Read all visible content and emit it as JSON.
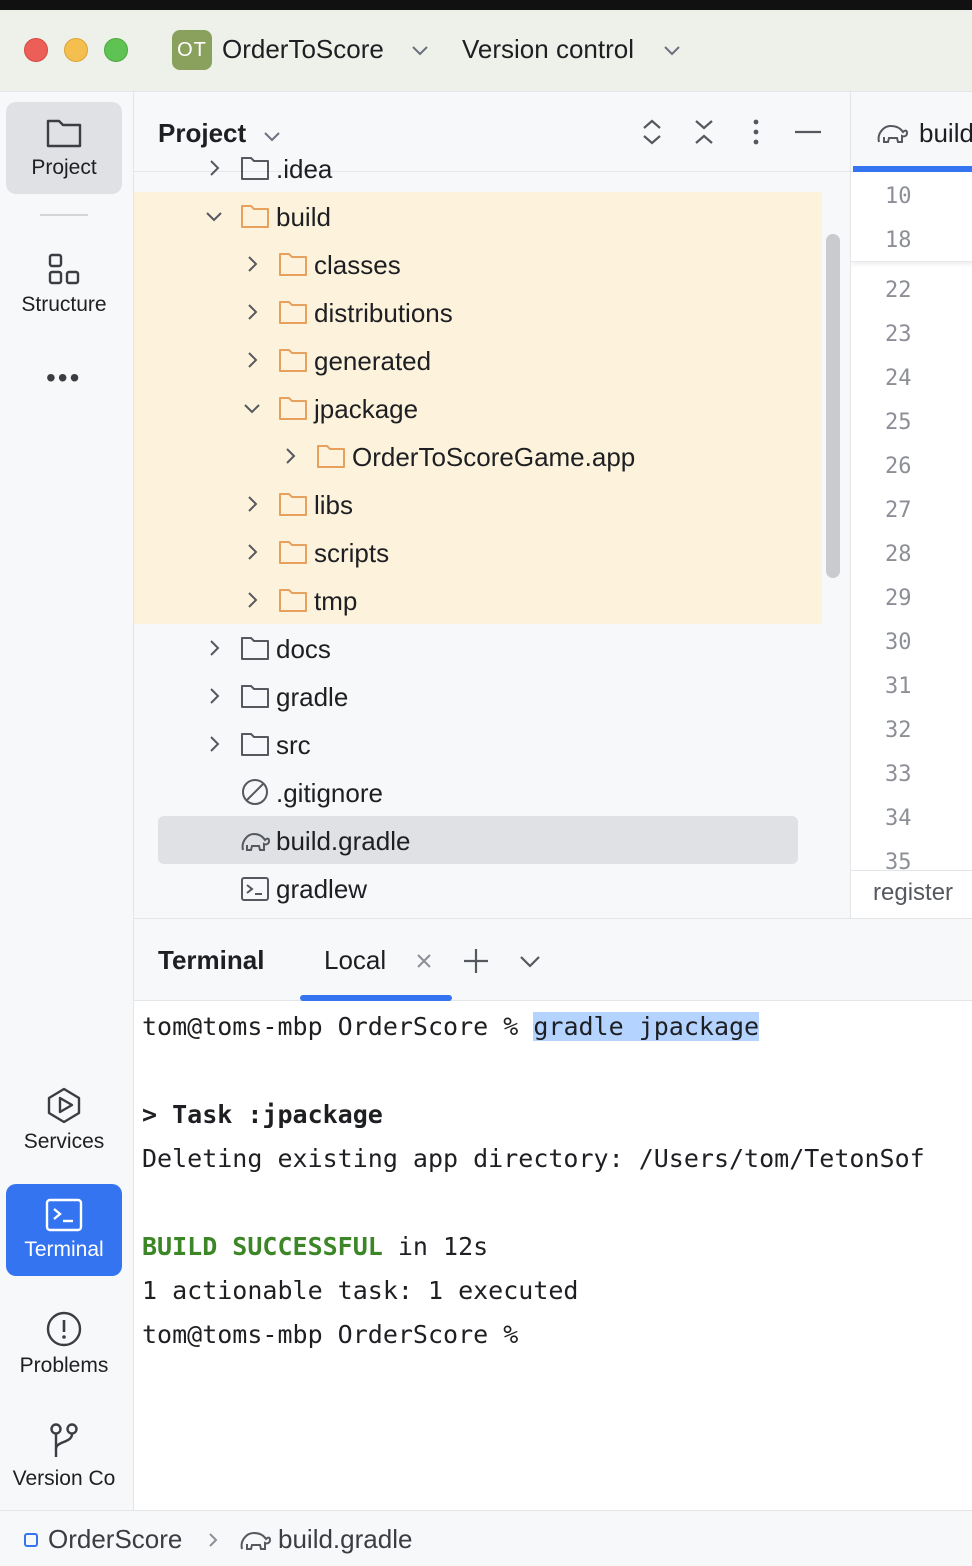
{
  "titlebar": {
    "project_badge": "OT",
    "project_name": "OrderToScore",
    "version_control": "Version control"
  },
  "toolstrip": {
    "top": [
      {
        "label": "Project",
        "icon": "folder-icon"
      },
      {
        "label": "Structure",
        "icon": "structure-icon"
      }
    ],
    "bottom": [
      {
        "label": "Services",
        "icon": "services-icon"
      },
      {
        "label": "Terminal",
        "icon": "terminal-icon"
      },
      {
        "label": "Problems",
        "icon": "problems-icon"
      },
      {
        "label": "Version Co",
        "icon": "git-branch-icon"
      }
    ]
  },
  "project_panel": {
    "title": "Project",
    "tree": [
      {
        "name": ".idea",
        "depth": 0,
        "expanded": false,
        "type": "folder"
      },
      {
        "name": "build",
        "depth": 0,
        "expanded": true,
        "type": "folder-excluded"
      },
      {
        "name": "classes",
        "depth": 1,
        "expanded": false,
        "type": "folder-excluded"
      },
      {
        "name": "distributions",
        "depth": 1,
        "expanded": false,
        "type": "folder-excluded"
      },
      {
        "name": "generated",
        "depth": 1,
        "expanded": false,
        "type": "folder-excluded"
      },
      {
        "name": "jpackage",
        "depth": 1,
        "expanded": true,
        "type": "folder-excluded"
      },
      {
        "name": "OrderToScoreGame.app",
        "depth": 2,
        "expanded": false,
        "type": "folder-excluded"
      },
      {
        "name": "libs",
        "depth": 1,
        "expanded": false,
        "type": "folder-excluded"
      },
      {
        "name": "scripts",
        "depth": 1,
        "expanded": false,
        "type": "folder-excluded"
      },
      {
        "name": "tmp",
        "depth": 1,
        "expanded": false,
        "type": "folder-excluded"
      },
      {
        "name": "docs",
        "depth": 0,
        "expanded": false,
        "type": "folder"
      },
      {
        "name": "gradle",
        "depth": 0,
        "expanded": false,
        "type": "folder"
      },
      {
        "name": "src",
        "depth": 0,
        "expanded": false,
        "type": "folder"
      },
      {
        "name": ".gitignore",
        "depth": 0,
        "type": "ignore-file"
      },
      {
        "name": "build.gradle",
        "depth": 0,
        "type": "gradle-file",
        "selected": true
      },
      {
        "name": "gradlew",
        "depth": 0,
        "type": "shell-file"
      }
    ]
  },
  "editor": {
    "tab_label": "build",
    "sticky_lines": [
      "10",
      "18"
    ],
    "line_numbers": [
      "22",
      "23",
      "24",
      "25",
      "26",
      "27",
      "28",
      "29",
      "30",
      "31",
      "32",
      "33",
      "34",
      "35"
    ],
    "breadcrumb": "register"
  },
  "terminal": {
    "title": "Terminal",
    "tab": "Local",
    "lines": {
      "prompt1": "tom@toms-mbp OrderScore % ",
      "command": "gradle jpackage",
      "task": "> Task :jpackage",
      "deleting": "Deleting existing app directory: /Users/tom/TetonSof",
      "build_status": "BUILD SUCCESSFUL",
      "build_time": " in 12s",
      "actionable": "1 actionable task: 1 executed",
      "prompt2": "tom@toms-mbp OrderScore %"
    }
  },
  "statusbar": {
    "project": "OrderScore",
    "file": "build.gradle"
  },
  "colors": {
    "accent": "#3574f0",
    "excluded_folder_bg": "#fdf3dd",
    "excluded_folder_icon": "#e8a15c",
    "success_green": "#3c8628",
    "selection": "#b5d3ff"
  }
}
